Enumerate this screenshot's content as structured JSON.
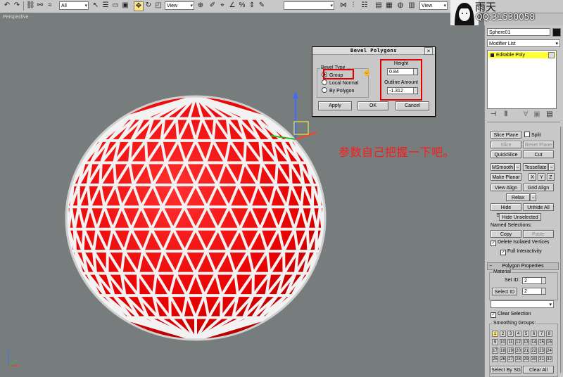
{
  "toolbar": {
    "filter_value": "All",
    "refcoord1": "View",
    "refcoord2": "View"
  },
  "viewport": {
    "label": "Perspective"
  },
  "watermark": {
    "name": "雨天",
    "qq": "QQ:31530058"
  },
  "dialog": {
    "title": "Bevel Polygons",
    "group_title": "Bevel Type",
    "radios": [
      "Group",
      "Local Normal",
      "By Polygon"
    ],
    "height_label": "Height",
    "height_value": "0.84",
    "outline_label": "Outline Amount",
    "outline_value": "-1.312",
    "apply": "Apply",
    "ok": "OK",
    "cancel": "Cancel"
  },
  "note": "参数自己把握一下吧。",
  "panel": {
    "object_name": "Sphere01",
    "modifier_list": "Modifier List",
    "stack_item": "Editable Poly",
    "edit": {
      "slice_plane": "Slice Plane",
      "split": "Split",
      "slice": "Slice",
      "reset_plane": "Reset Plane",
      "quickslice": "QuickSlice",
      "cut": "Cut",
      "msmooth": "MSmooth",
      "tessellate": "Tessellate",
      "make_planar": "Make Planar",
      "x": "X",
      "y": "Y",
      "z": "Z",
      "view_align": "View Align",
      "grid_align": "Grid Align",
      "relax": "Relax",
      "hide_selected": "Hide Selected",
      "unhide_all": "Unhide All",
      "hide_unselected": "Hide Unselected",
      "named_selections": "Named Selections:",
      "copy": "Copy",
      "paste": "Paste",
      "delete_isolated": "Delete Isolated Vertices",
      "full_interactivity": "Full Interactivity"
    },
    "poly_props": {
      "title": "Polygon Properties",
      "material": "Material",
      "set_id": "Set ID:",
      "set_id_val": "2",
      "select_id": "Select ID",
      "select_id_val": "2",
      "clear_selection": "Clear Selection",
      "smoothing_groups": "Smoothing Groups:",
      "groups": [
        "1",
        "2",
        "3",
        "4",
        "5",
        "6",
        "7",
        "8",
        "9",
        "10",
        "11",
        "12",
        "13",
        "14",
        "15",
        "16",
        "17",
        "18",
        "19",
        "20",
        "21",
        "22",
        "23",
        "24",
        "25",
        "26",
        "27",
        "28",
        "29",
        "30",
        "31",
        "32"
      ],
      "select_by_sg": "Select By SG",
      "clear_all": "Clear All"
    }
  },
  "colors": {
    "sphere_red": "#f00000",
    "sphere_frame": "#f2f2f2",
    "highlight_red": "#e00000",
    "stack_yellow": "#ffff33"
  }
}
